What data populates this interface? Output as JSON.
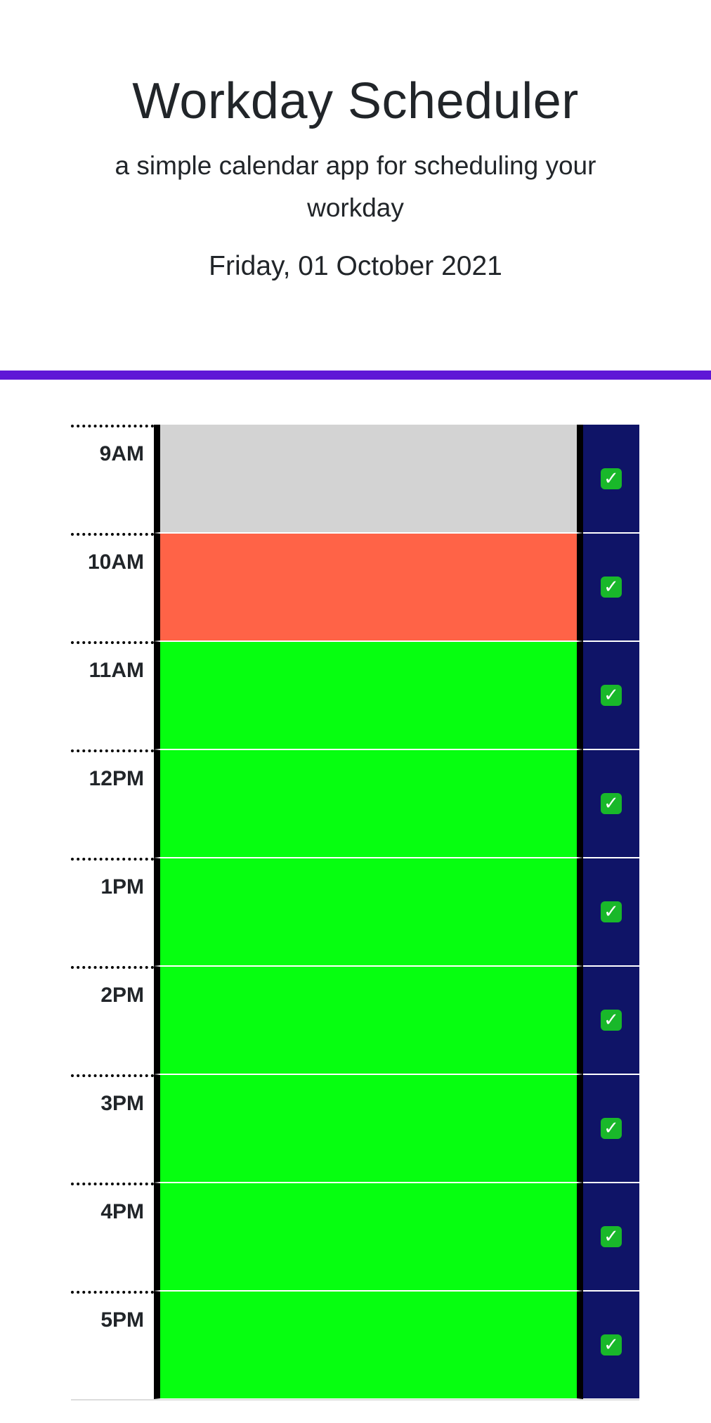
{
  "header": {
    "title": "Workday Scheduler",
    "subtitle": "a simple calendar app for scheduling your workday",
    "date": "Friday, 01 October 2021"
  },
  "colors": {
    "accent_bar": "#5f17d6",
    "past": "#d3d3d3",
    "present": "#ff6347",
    "future": "#06ff10",
    "save_button": "#0f1467"
  },
  "schedule": {
    "rows": [
      {
        "hour": "9AM",
        "status": "past",
        "text": "",
        "save_icon": "check-mark-icon"
      },
      {
        "hour": "10AM",
        "status": "present",
        "text": "",
        "save_icon": "check-mark-icon"
      },
      {
        "hour": "11AM",
        "status": "future",
        "text": "",
        "save_icon": "check-mark-icon"
      },
      {
        "hour": "12PM",
        "status": "future",
        "text": "",
        "save_icon": "check-mark-icon"
      },
      {
        "hour": "1PM",
        "status": "future",
        "text": "",
        "save_icon": "check-mark-icon"
      },
      {
        "hour": "2PM",
        "status": "future",
        "text": "",
        "save_icon": "check-mark-icon"
      },
      {
        "hour": "3PM",
        "status": "future",
        "text": "",
        "save_icon": "check-mark-icon"
      },
      {
        "hour": "4PM",
        "status": "future",
        "text": "",
        "save_icon": "check-mark-icon"
      },
      {
        "hour": "5PM",
        "status": "future",
        "text": "",
        "save_icon": "check-mark-icon"
      }
    ],
    "check_glyph": "✓"
  }
}
